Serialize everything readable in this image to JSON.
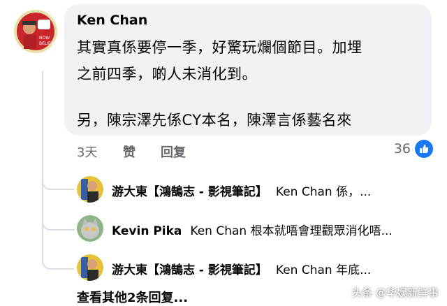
{
  "comment": {
    "author": "Ken Chan",
    "lines": [
      "其實真係要停一季，好驚玩爛個節目。加埋",
      "之前四季，啲人未消化到。",
      "",
      "另，陳宗澤先係CY本名，陳澤言係藝名來"
    ],
    "time": "3天",
    "like_label": "赞",
    "reply_label": "回复",
    "reaction_count": "36"
  },
  "replies": [
    {
      "name": "游大東【鴻鵠志 - 影視筆記】",
      "text": "Ken Chan 係，..."
    },
    {
      "name": "Kevin Pika",
      "text": "Ken Chan 根本就唔會理觀眾消化唔..."
    },
    {
      "name": "游大東【鴻鵠志 - 影視筆記】",
      "text": "Ken Chan 年底..."
    }
  ],
  "more_replies": "查看其他2条回复...",
  "watermark": "头条 @华娱新鲜事",
  "colors": {
    "bubble": "#f0f2f5",
    "secondary_text": "#65676b",
    "like_blue": "#1877f2",
    "thread_line": "#dadde1"
  }
}
